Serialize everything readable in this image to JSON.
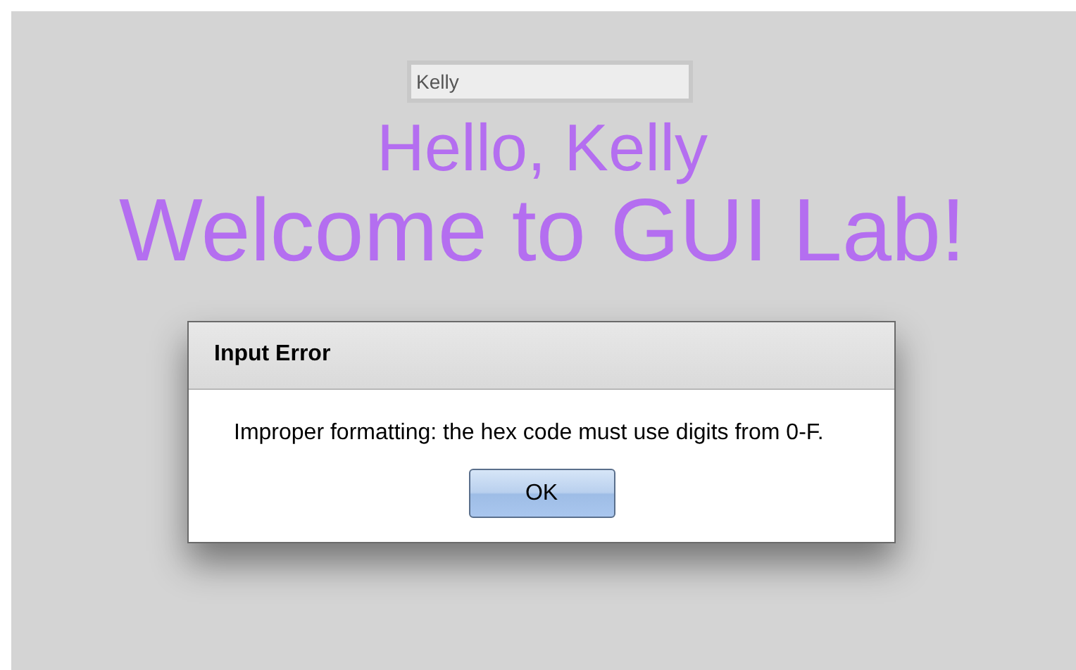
{
  "name_field": {
    "value": "Kelly"
  },
  "greeting": "Hello, Kelly",
  "heading": "Welcome to GUI Lab!",
  "dialog": {
    "title": "Input Error",
    "message": "Improper formatting: the hex code must use digits from 0-F.",
    "buttons": [
      "OK"
    ]
  }
}
